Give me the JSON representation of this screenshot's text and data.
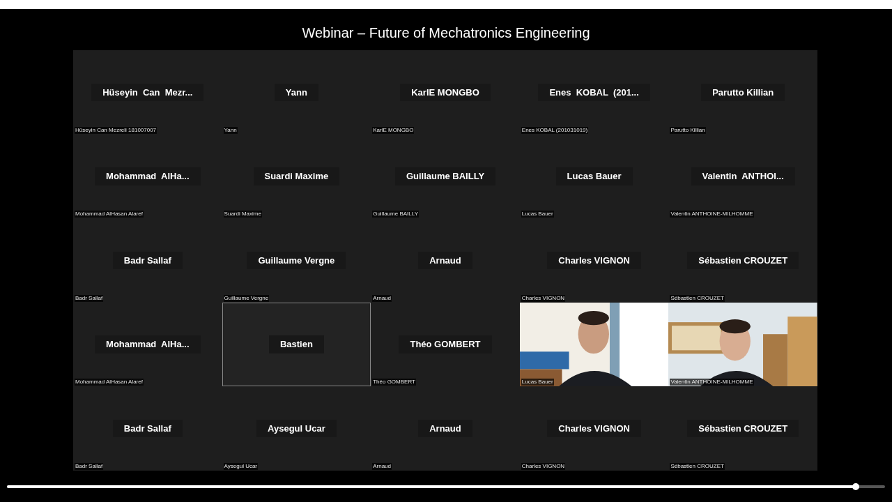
{
  "title": "Webinar – Future of Mechatronics Engineering",
  "tiles": [
    {
      "kind": "name",
      "name": "Hüseyin  Can  Mezr...",
      "caption": "Hüseyin Can Mezreli 181007007",
      "highlighted": false
    },
    {
      "kind": "name",
      "name": "Yann",
      "caption": "Yann",
      "highlighted": false
    },
    {
      "kind": "name",
      "name": "KarlE MONGBO",
      "caption": "KarlE MONGBO",
      "highlighted": false
    },
    {
      "kind": "name",
      "name": "Enes  KOBAL  (201...",
      "caption": "Enes KOBAL (201031019)",
      "highlighted": false
    },
    {
      "kind": "name",
      "name": "Parutto Killian",
      "caption": "Parutto Killian",
      "highlighted": false
    },
    {
      "kind": "name",
      "name": "Mohammad  AlHa...",
      "caption": "Mohammad AlHasan Alaref",
      "highlighted": false
    },
    {
      "kind": "name",
      "name": "Suardi Maxime",
      "caption": "Suardi Maxime",
      "highlighted": false
    },
    {
      "kind": "name",
      "name": "Guillaume BAILLY",
      "caption": "Guillaume BAILLY",
      "highlighted": false
    },
    {
      "kind": "name",
      "name": "Lucas Bauer",
      "caption": "Lucas Bauer",
      "highlighted": false
    },
    {
      "kind": "name",
      "name": "Valentin  ANTHOI...",
      "caption": "Valentin ANTHOINE-MILHOMME",
      "highlighted": false
    },
    {
      "kind": "name",
      "name": "Badr Sallaf",
      "caption": "Badr Sallaf",
      "highlighted": false
    },
    {
      "kind": "name",
      "name": "Guillaume Vergne",
      "caption": "Guillaume Vergne",
      "highlighted": false
    },
    {
      "kind": "name",
      "name": "Arnaud",
      "caption": "Arnaud",
      "highlighted": false
    },
    {
      "kind": "name",
      "name": "Charles VIGNON",
      "caption": "Charles VIGNON",
      "highlighted": false
    },
    {
      "kind": "name",
      "name": "Sébastien CROUZET",
      "caption": "Sébastien CROUZET",
      "highlighted": false
    },
    {
      "kind": "name",
      "name": "Mohammad  AlHa...",
      "caption": "Mohammad AlHasan Alaref",
      "highlighted": false
    },
    {
      "kind": "name",
      "name": "Bastien",
      "highlighted": true
    },
    {
      "kind": "name",
      "name": "Théo GOMBERT",
      "caption": "Théo GOMBERT",
      "highlighted": false
    },
    {
      "kind": "video",
      "caption": "Lucas Bauer",
      "highlighted": false
    },
    {
      "kind": "video",
      "caption": "Valentin ANTHOINE-MILHOMME",
      "highlighted": false
    },
    {
      "kind": "name",
      "name": "Badr Sallaf",
      "caption": "Badr Sallaf",
      "highlighted": false
    },
    {
      "kind": "name",
      "name": "Aysegul Ucar",
      "caption": "Aysegul Ucar",
      "highlighted": false
    },
    {
      "kind": "name",
      "name": "Arnaud",
      "caption": "Arnaud",
      "highlighted": false
    },
    {
      "kind": "name",
      "name": "Charles VIGNON",
      "caption": "Charles VIGNON",
      "highlighted": false
    },
    {
      "kind": "name",
      "name": "Sébastien CROUZET",
      "caption": "Sébastien CROUZET",
      "highlighted": false
    }
  ],
  "seek_bar": {
    "level": 0.967
  }
}
